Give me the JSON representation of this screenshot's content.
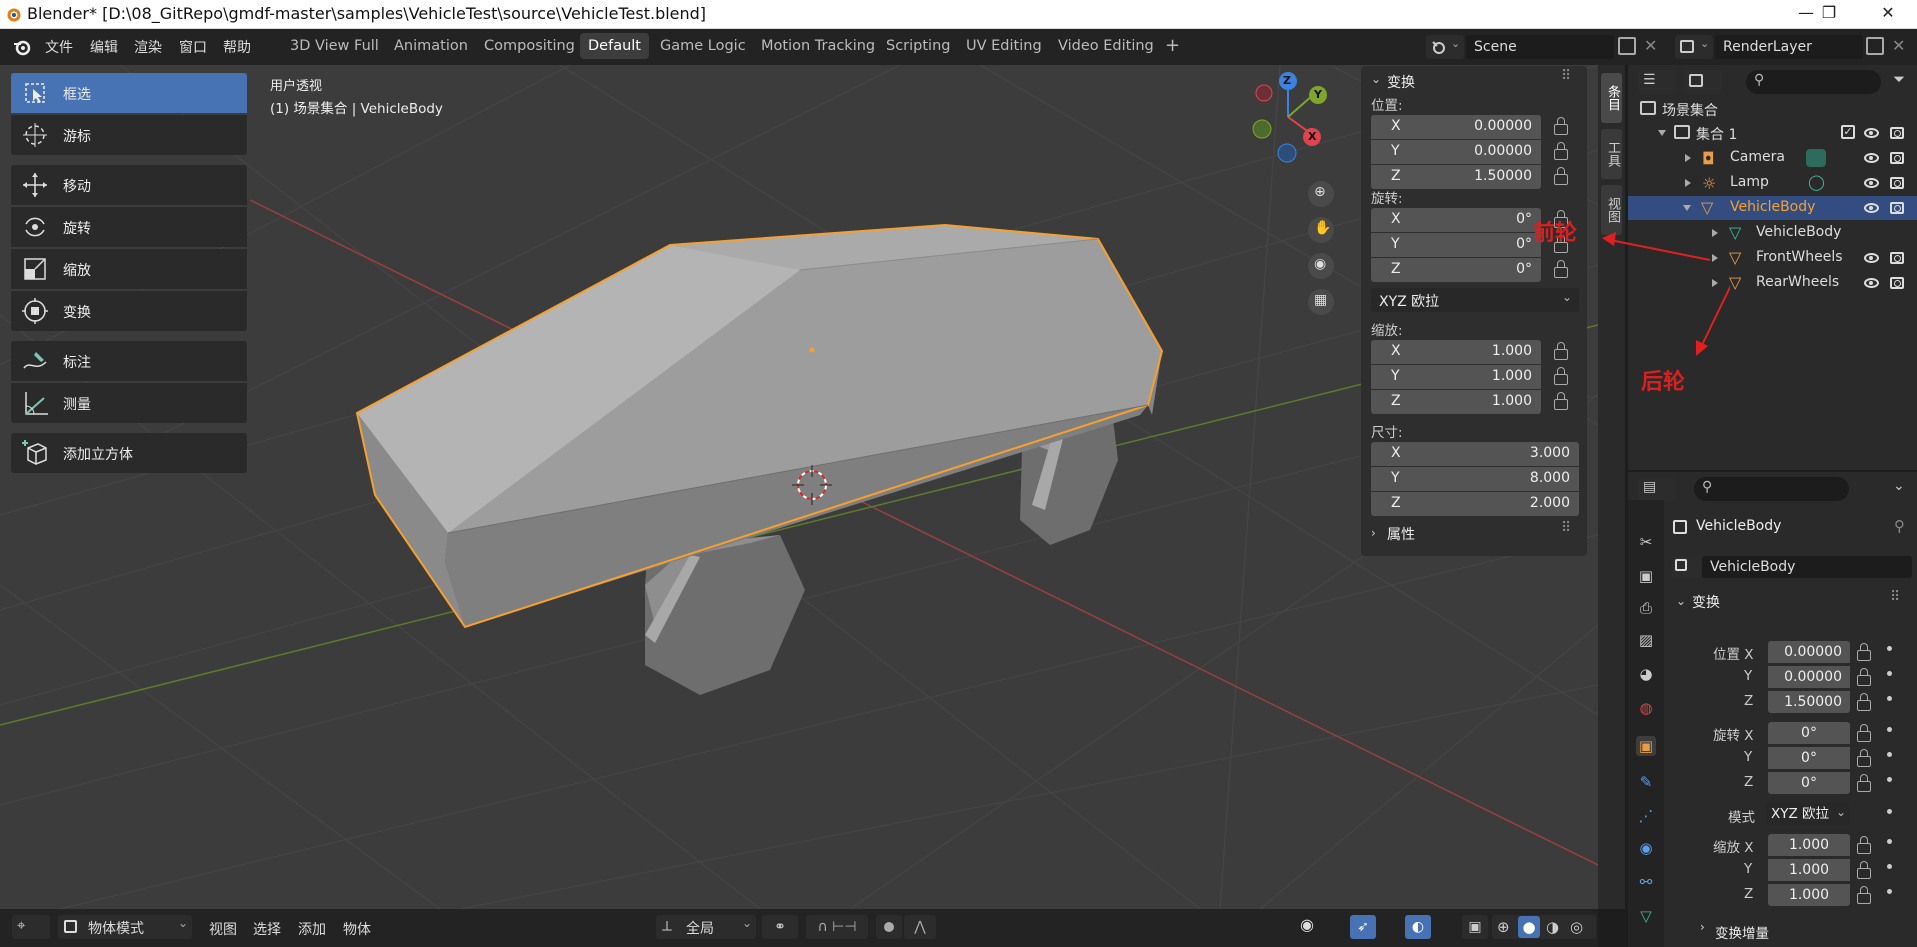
{
  "window": {
    "title": "Blender* [D:\\08_GitRepo\\gmdf-master\\samples\\VehicleTest\\source\\VehicleTest.blend]",
    "controls": [
      "—",
      "❐",
      "✕"
    ]
  },
  "menu": {
    "items": [
      "文件",
      "编辑",
      "渲染",
      "窗口",
      "帮助"
    ]
  },
  "workspaces": {
    "tabs": [
      "3D View Full",
      "Animation",
      "Compositing",
      "Default",
      "Game Logic",
      "Motion Tracking",
      "Scripting",
      "UV Editing",
      "Video Editing",
      "+"
    ],
    "active": "Default"
  },
  "scene": {
    "name": "Scene"
  },
  "render_layer": {
    "name": "RenderLayer"
  },
  "viewport": {
    "view_name": "用户透视",
    "context": "(1) 场景集合 | VehicleBody"
  },
  "toolbar": {
    "tools": [
      {
        "label": "框选",
        "icon": "select-box-icon"
      },
      {
        "label": "游标",
        "icon": "cursor-icon"
      },
      {
        "label": "移动",
        "icon": "move-icon"
      },
      {
        "label": "旋转",
        "icon": "rotate-icon"
      },
      {
        "label": "缩放",
        "icon": "scale-icon"
      },
      {
        "label": "变换",
        "icon": "transform-icon"
      },
      {
        "label": "标注",
        "icon": "annotate-icon"
      },
      {
        "label": "测量",
        "icon": "measure-icon"
      },
      {
        "label": "添加立方体",
        "icon": "add-cube-icon"
      }
    ],
    "active": "框选"
  },
  "gizmo": {
    "x": "X",
    "y": "Y",
    "z": "Z"
  },
  "npanel": {
    "header": "变换",
    "location_label": "位置:",
    "location": {
      "x": "0.00000",
      "y": "0.00000",
      "z": "1.50000"
    },
    "rotation_label": "旋转:",
    "rotation": {
      "x": "0°",
      "y": "0°",
      "z": "0°"
    },
    "rotation_mode": "XYZ 欧拉",
    "scale_label": "缩放:",
    "scale": {
      "x": "1.000",
      "y": "1.000",
      "z": "1.000"
    },
    "dimensions_label": "尺寸:",
    "dimensions": {
      "x": "3.000",
      "y": "8.000",
      "z": "2.000"
    },
    "axis": {
      "x": "X",
      "y": "Y",
      "z": "Z"
    },
    "properties_header": "属性"
  },
  "sidetabs": [
    "条目",
    "工具",
    "视图"
  ],
  "outliner": {
    "root": "场景集合",
    "collection": "集合 1",
    "items": [
      {
        "name": "Camera",
        "indent": 1
      },
      {
        "name": "Lamp",
        "indent": 1
      },
      {
        "name": "VehicleBody",
        "indent": 1,
        "selected": true
      },
      {
        "name": "VehicleBody",
        "indent": 2
      },
      {
        "name": "FrontWheels",
        "indent": 2
      },
      {
        "name": "RearWheels",
        "indent": 2
      }
    ]
  },
  "annotations": {
    "front": "前轮",
    "rear": "后轮"
  },
  "properties": {
    "object_name": "VehicleBody",
    "data_name": "VehicleBody",
    "section": "变换",
    "location_label": "位置 X",
    "location": {
      "x": "0.00000",
      "y": "0.00000",
      "z": "1.50000"
    },
    "rotation_label": "旋转 X",
    "rotation": {
      "x": "0°",
      "y": "0°",
      "z": "0°"
    },
    "mode_label": "模式",
    "mode": "XYZ 欧拉",
    "scale_label": "缩放 X",
    "scale": {
      "x": "1.000",
      "y": "1.000",
      "z": "1.000"
    },
    "axis_y": "Y",
    "axis_z": "Z",
    "delta": "变换增量"
  },
  "statusbar": {
    "mode": "物体模式",
    "menus": [
      "视图",
      "选择",
      "添加",
      "物体"
    ],
    "pivot": "全局"
  },
  "colors": {
    "accent": "#4772b3",
    "selection": "#f5a030",
    "annotation": "#d82020",
    "axis_x": "#e0434f",
    "axis_y": "#7ea62a",
    "axis_z": "#3b83e0"
  }
}
